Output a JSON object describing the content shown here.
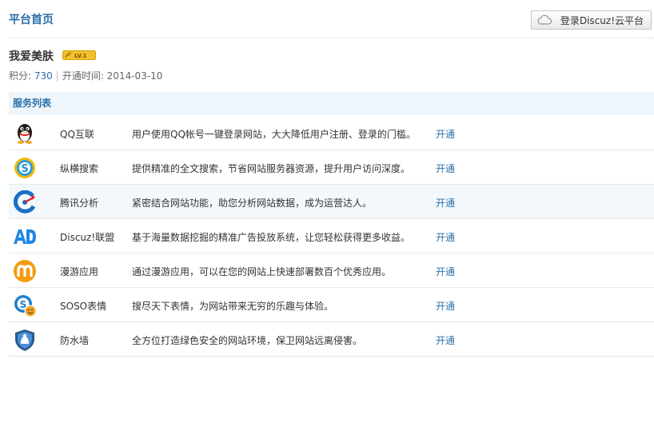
{
  "header": {
    "title": "平台首页",
    "login_button": "登录Discuz!云平台"
  },
  "site": {
    "name": "我爱美肤",
    "level_badge": "LV.1",
    "points_label": "积分: ",
    "points": "730",
    "separator": "|",
    "open_time_label": "开通时间: ",
    "open_time": "2014-03-10"
  },
  "services": {
    "title": "服务列表",
    "items": [
      {
        "icon": "qq-penguin-icon",
        "name": "QQ互联",
        "desc": "用户使用QQ帐号一键登录网站，大大降低用户注册、登录的门槛。",
        "action": "开通"
      },
      {
        "icon": "soso-search-icon",
        "name": "纵横搜索",
        "desc": "提供精准的全文搜索，节省网站服务器资源，提升用户访问深度。",
        "action": "开通"
      },
      {
        "icon": "tencent-analytics-icon",
        "name": "腾讯分析",
        "desc": "紧密结合网站功能，助您分析网站数据，成为运营达人。",
        "action": "开通"
      },
      {
        "icon": "ad-union-icon",
        "name": "Discuz!联盟",
        "desc": "基于海量数据挖掘的精准广告投放系统，让您轻松获得更多收益。",
        "action": "开通"
      },
      {
        "icon": "manyou-icon",
        "name": "漫游应用",
        "desc": "通过漫游应用，可以在您的网站上快速部署数百个优秀应用。",
        "action": "开通"
      },
      {
        "icon": "soso-emoticon-icon",
        "name": "SOSO表情",
        "desc": "搜尽天下表情，为网站带来无穷的乐趣与体验。",
        "action": "开通"
      },
      {
        "icon": "firewall-shield-icon",
        "name": "防水墙",
        "desc": "全方位打造绿色安全的网站环境，保卫网站远离侵害。",
        "action": "开通"
      }
    ]
  }
}
